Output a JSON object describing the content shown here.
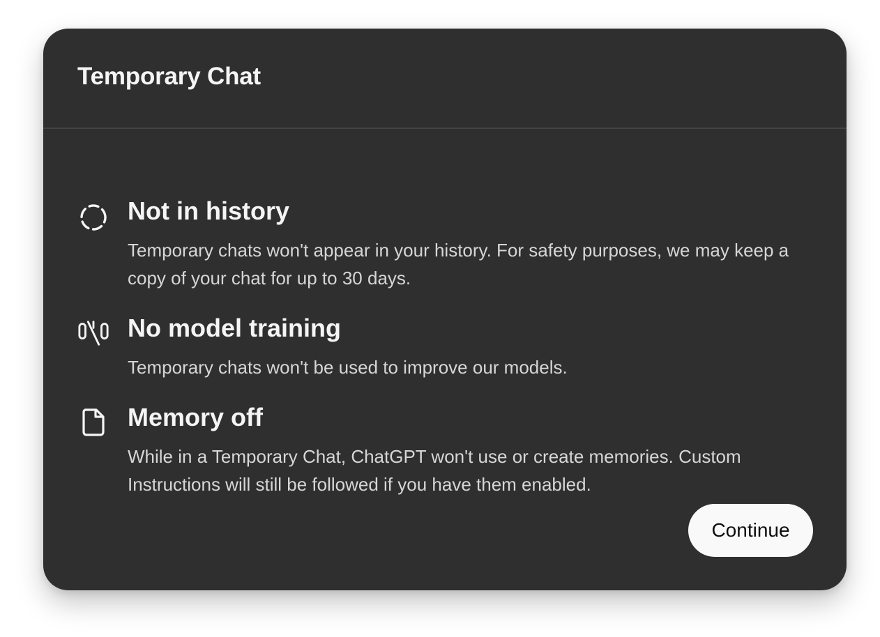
{
  "modal": {
    "title": "Temporary Chat",
    "features": [
      {
        "icon": "dashed-circle-icon",
        "title": "Not in history",
        "description": "Temporary chats won't appear in your history. For safety purposes, we may keep a copy of your chat for up to 30 days."
      },
      {
        "icon": "no-training-icon",
        "title": "No model training",
        "description": "Temporary chats won't be used to improve our models."
      },
      {
        "icon": "document-icon",
        "title": "Memory off",
        "description": "While in a Temporary Chat, ChatGPT won't use or create memories. Custom Instructions will still be followed if you have them enabled."
      }
    ],
    "continue_label": "Continue"
  },
  "colors": {
    "modal_background": "#2f2f2f",
    "button_background": "#f9f9f9",
    "text_primary": "#f5f5f5",
    "text_secondary": "#d6d6d6"
  }
}
